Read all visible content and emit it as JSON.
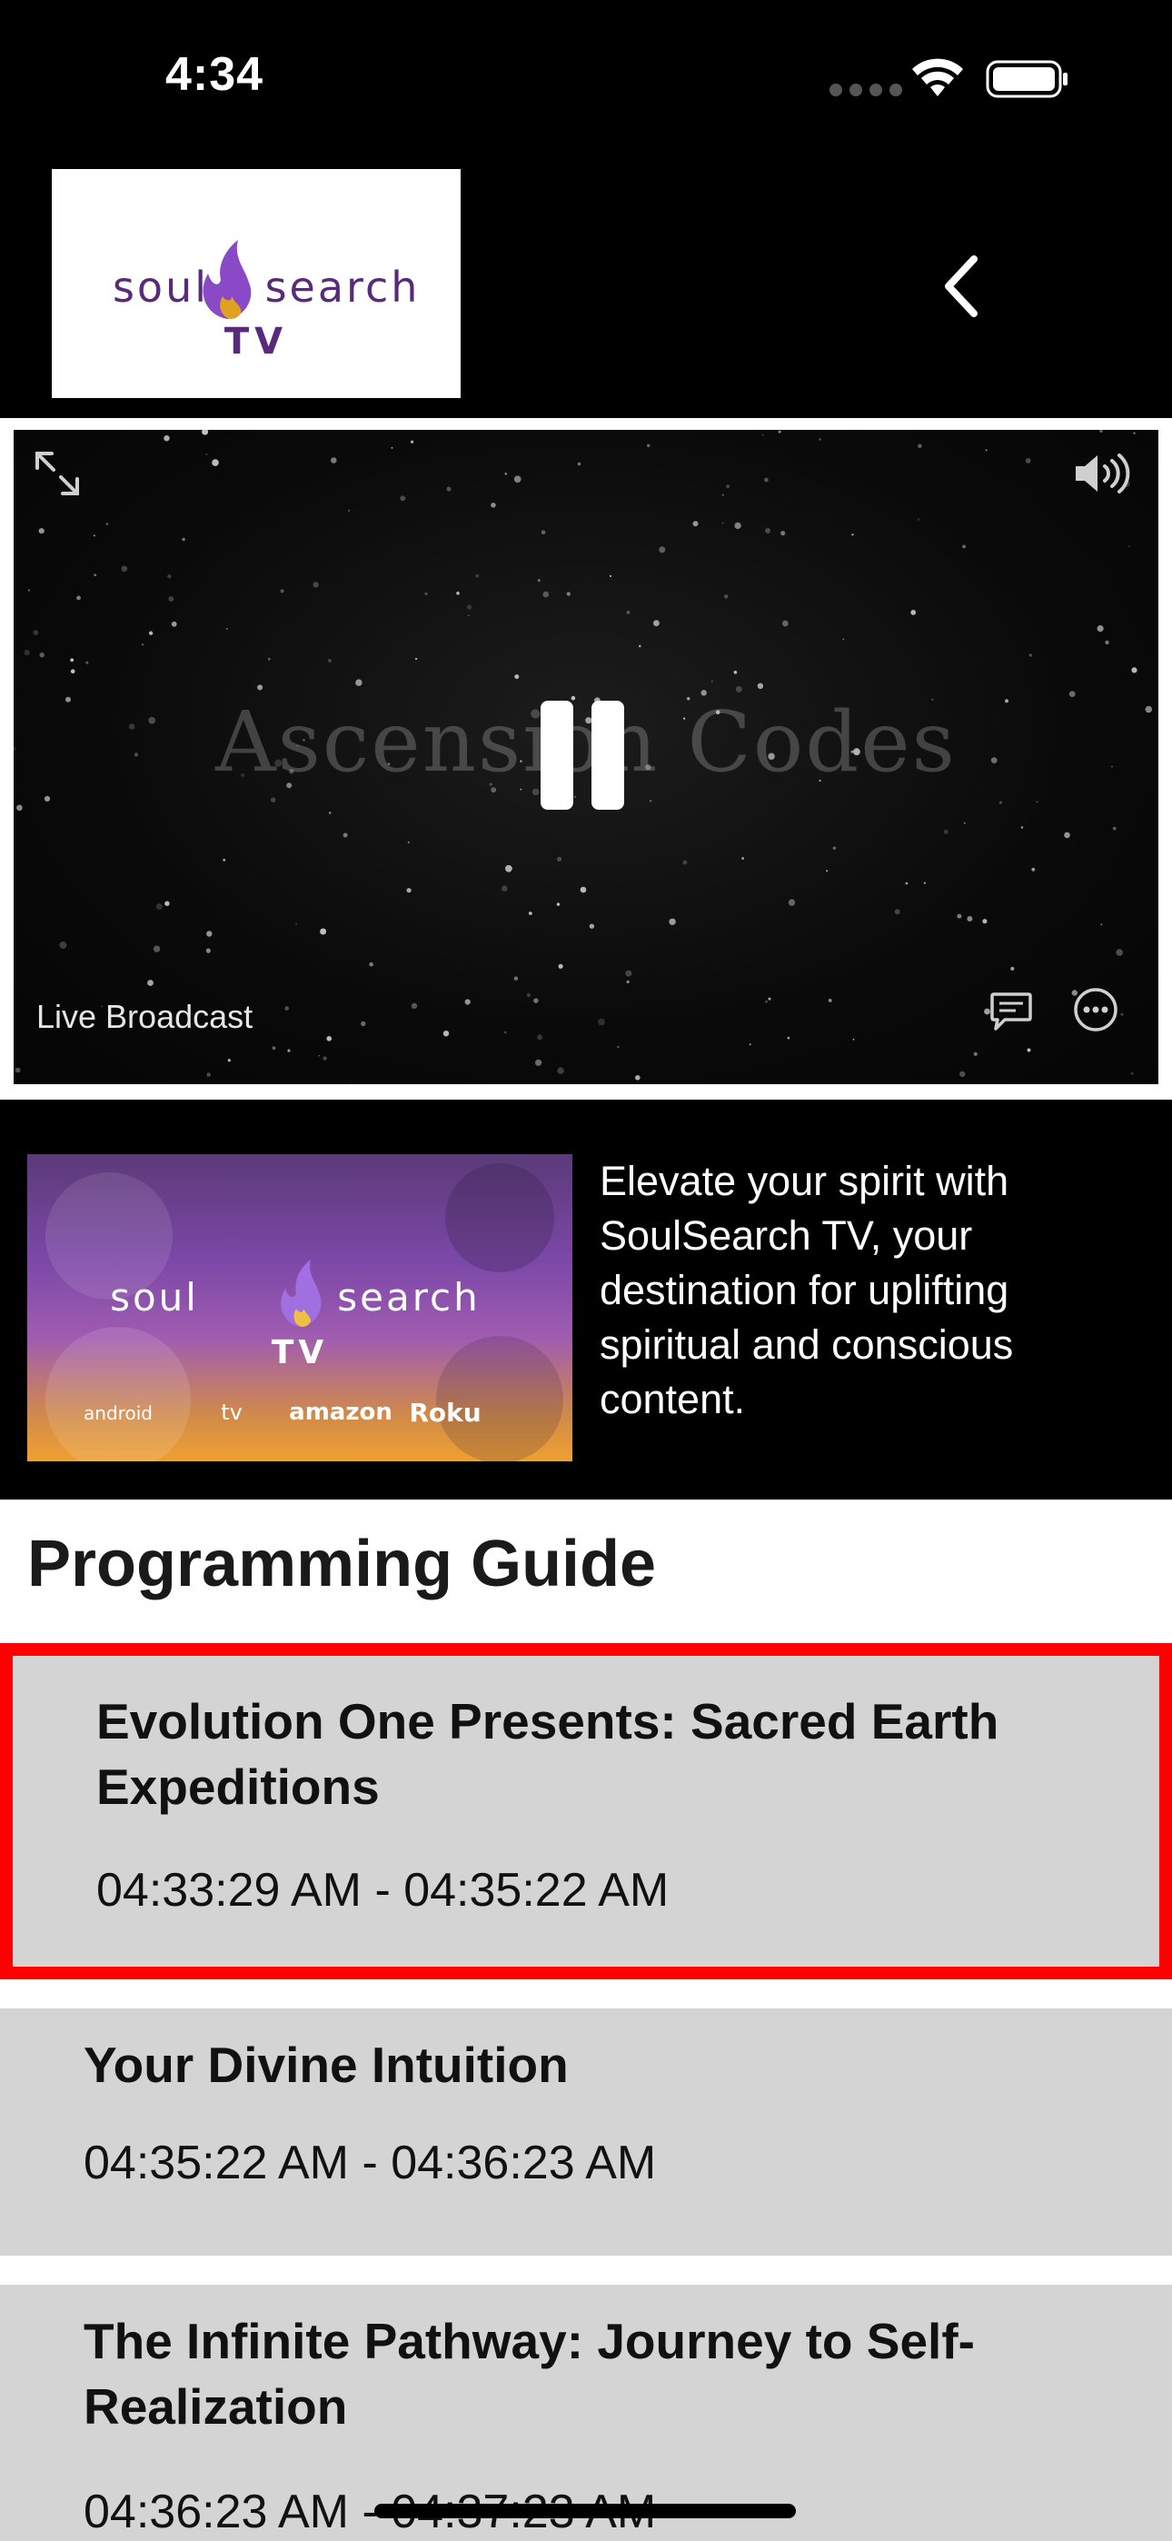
{
  "status_bar": {
    "time": "4:34",
    "icons": [
      "signal-dots-icon",
      "wifi-icon",
      "battery-icon"
    ]
  },
  "header": {
    "logo": {
      "brand_left": "soul",
      "brand_right": "search",
      "brand_sub": "TV"
    },
    "back_icon": "chevron-left-icon"
  },
  "player": {
    "overlay_title": "Ascension Codes",
    "status_label": "Live Broadcast",
    "controls": [
      "expand-icon",
      "volume-icon",
      "pause-icon",
      "captions-icon",
      "more-icon"
    ]
  },
  "promo": {
    "image_logo": {
      "brand_left": "soul",
      "brand_right": "search",
      "brand_sub": "TV"
    },
    "platforms": [
      "android",
      "tv",
      "amazon",
      "Roku"
    ],
    "description": "Elevate your spirit with SoulSearch TV, your destination for uplifting spiritual and conscious content."
  },
  "guide": {
    "heading": "Programming Guide",
    "items": [
      {
        "title_line1": "Evolution One Presents: Sacred Earth",
        "title_line2": "Expeditions",
        "time": "04:33:29 AM - 04:35:22 AM",
        "selected": true
      },
      {
        "title_line1": "Your Divine Intuition",
        "title_line2": "",
        "time": "04:35:22 AM - 04:36:23 AM",
        "selected": false
      },
      {
        "title_line1": "The Infinite Pathway: Journey to Self-",
        "title_line2": "Realization",
        "time": "04:36:23 AM - 04:37:23 AM",
        "selected": false
      }
    ]
  },
  "colors": {
    "selection_border": "#ff0000",
    "guide_item_bg": "#d4d4d4",
    "brand_purple": "#5a2a7a",
    "flame_purple": "#8a4ac8",
    "flame_gold": "#e0a020"
  }
}
